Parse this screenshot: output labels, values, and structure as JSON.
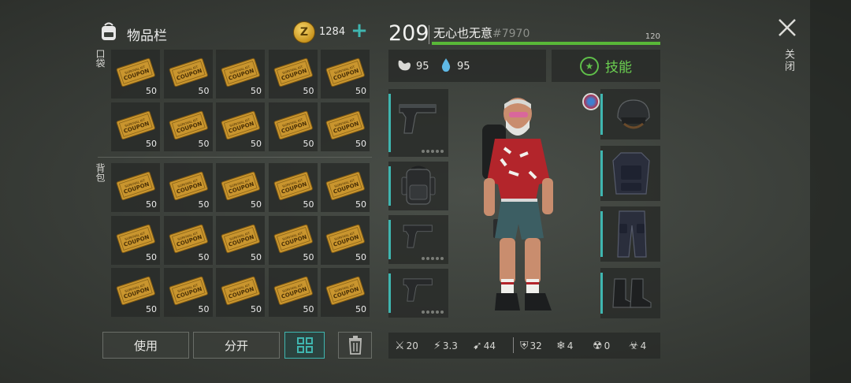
{
  "header": {
    "title": "物品栏",
    "coin_symbol": "Z",
    "coin_count": "1284",
    "add_label": "+"
  },
  "sections": {
    "pocket_label": "口袋",
    "backpack_label": "背包"
  },
  "item": {
    "name": "COUPON",
    "small_text": "SURVIVAL KIT",
    "quantity": "50"
  },
  "pocket_slots": [
    "50",
    "50",
    "50",
    "50",
    "50",
    "50",
    "50",
    "50",
    "50",
    "50"
  ],
  "backpack_slots": [
    "50",
    "50",
    "50",
    "50",
    "50",
    "50",
    "50",
    "50",
    "50",
    "50",
    "50",
    "50",
    "50",
    "50",
    "50"
  ],
  "actions": {
    "use": "使用",
    "split": "分开"
  },
  "player": {
    "level": "209",
    "name": "无心也无意",
    "id": "#7970",
    "xp_label": "120",
    "xp_fraction": 0.999
  },
  "stats": {
    "food": "95",
    "water": "95",
    "skills_label": "技能"
  },
  "equipment_left": [
    "pistol-icon",
    "backpack-icon",
    "pistol-icon",
    "pistol-icon"
  ],
  "equipment_right": [
    "helmet-icon",
    "body-armor-icon",
    "pants-icon",
    "boots-icon"
  ],
  "bottom_stats": {
    "melee": "20",
    "speed": "3.3",
    "run": "44",
    "armor": "32",
    "cold": "4",
    "radiation": "0",
    "toxic": "4"
  },
  "close_label": "关闭",
  "colors": {
    "accent": "#3fb6b0",
    "xp": "#59b838",
    "skills": "#6bcf50"
  }
}
